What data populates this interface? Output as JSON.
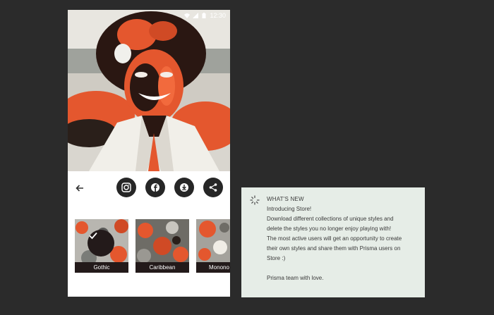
{
  "status_bar": {
    "time": "12:30"
  },
  "photo": {
    "description_icon": "stylized-portrait"
  },
  "toolbar": {
    "back_icon": "arrow-left-icon",
    "actions": [
      "instagram-icon",
      "facebook-icon",
      "download-icon",
      "share-icon"
    ]
  },
  "filters": [
    {
      "label": "Gothic",
      "selected": true
    },
    {
      "label": "Caribbean",
      "selected": false
    },
    {
      "label": "Monono",
      "selected": false
    }
  ],
  "notice": {
    "title": "WHAT'S NEW",
    "line1": "Introducing Store!",
    "line2": "Download different collections of unique styles and",
    "line3": "delete the styles you no longer enjoy playing with!",
    "line4": "The most active users will get an opportunity to create",
    "line5": "their own styles and share them with Prisma users on",
    "line6": "Store :)",
    "signoff": "Prisma team with love."
  },
  "colors": {
    "background": "#2b2b2b",
    "accent_orange": "#e4572e",
    "dark_button": "#262626",
    "notice_bg": "#e6ede7"
  }
}
